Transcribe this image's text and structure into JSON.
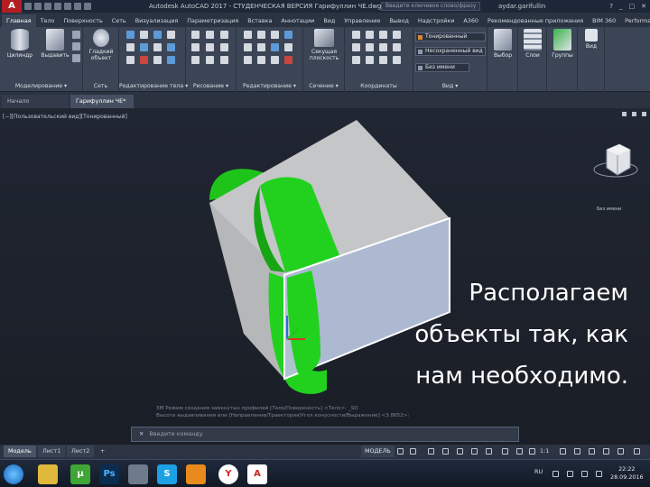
{
  "titlebar": {
    "app_badge": "A",
    "title": "Autodesk AutoCAD 2017 - СТУДЕНЧЕСКАЯ ВЕРСИЯ   Гарифуллин ЧЕ.dwg",
    "search_placeholder": "Введите ключевое слово/фразу",
    "user": "aydar.garifullin",
    "controls": [
      "?",
      "_",
      "□",
      "✕"
    ]
  },
  "ribbon_tabs": [
    "Главная",
    "Тело",
    "Поверхность",
    "Сеть",
    "Визуализация",
    "Параметризация",
    "Вставка",
    "Аннотации",
    "Вид",
    "Управление",
    "Вывод",
    "Надстройки",
    "A360",
    "Рекомендованные приложения",
    "BIM 360",
    "Performance"
  ],
  "ribbon_groups": {
    "modeling": {
      "label": "Моделирование ▾",
      "btn1": "Цилиндр",
      "btn2": "Выдавить"
    },
    "mesh": {
      "label": "Сеть",
      "btn": "Гладкий объект"
    },
    "solid_edit": {
      "label": "Редактирование тела ▾"
    },
    "draw": {
      "label": "Рисование ▾"
    },
    "modify": {
      "label": "Редактирование ▾"
    },
    "section": {
      "label": "Сечение ▾",
      "btn": "Секущая плоскость"
    },
    "coords": {
      "label": "Координаты"
    },
    "view": {
      "label": "Вид ▾",
      "visual_style": "Тонированный",
      "unsaved_view": "Несохраненный вид",
      "no_filter": "Без имени"
    },
    "selection": {
      "label": "Выбор"
    },
    "layers": {
      "label": "Слои"
    },
    "groups": {
      "label": "Группы"
    },
    "view2": {
      "label": "Вид"
    }
  },
  "file_tabs": [
    "Начало",
    "Гарифуллин ЧЕ*"
  ],
  "viewport": {
    "label": "[−][Пользовательский вид][Тонированный]",
    "viewcube_label": "Без имени",
    "overlay_lines": [
      "Располагаем",
      "объекты так, как",
      "нам необходимо."
    ],
    "cmd_history": [
      "ЗМ Режим создания замкнутых профилей [Тело/Поверхность] <Тело>: _SO",
      "Высота выдавливания или [Направление/Траектория/Угол конусности/Выражение] <3.8652>:"
    ],
    "cmd_placeholder": "Введите команду",
    "cmd_icon": "✕"
  },
  "layout_tabs": [
    "Модель",
    "Лист1",
    "Лист2",
    "+"
  ],
  "statusbar": {
    "model": "МОДЕЛЬ",
    "scale": "1:1"
  },
  "taskbar": {
    "apps": [
      "",
      "",
      "µ",
      "Ps",
      "",
      "S",
      "",
      "Y",
      "A"
    ],
    "lang": "RU",
    "time": "22:22",
    "date": "28.09.2016"
  },
  "colors": {
    "green_solid": "#22d11e",
    "box_gray": "#c4c6c8",
    "box_blue": "#b5c2da",
    "accent_red": "#b21e23"
  }
}
